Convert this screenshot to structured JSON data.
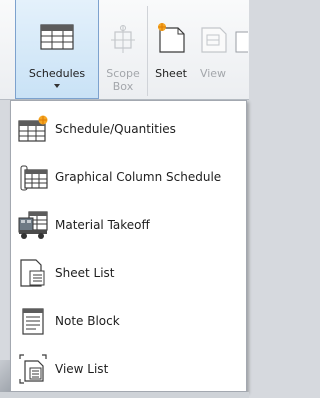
{
  "ribbon": {
    "schedules_label": "Schedules",
    "scope_box_label_line1": "Scope",
    "scope_box_label_line2": "Box",
    "sheet_label": "Sheet",
    "view_label": "View"
  },
  "menu": {
    "items": [
      {
        "label": "Schedule/Quantities",
        "icon": "schedule-quantities-icon"
      },
      {
        "label": "Graphical Column Schedule",
        "icon": "graphical-column-schedule-icon"
      },
      {
        "label": "Material Takeoff",
        "icon": "material-takeoff-icon"
      },
      {
        "label": "Sheet List",
        "icon": "sheet-list-icon"
      },
      {
        "label": "Note Block",
        "icon": "note-block-icon"
      },
      {
        "label": "View List",
        "icon": "view-list-icon"
      }
    ]
  },
  "colors": {
    "active_button_fill": "#c9e2f6",
    "active_button_border": "#7da2ce",
    "disabled_text": "#a3a6ab",
    "accent_orange": "#f5a623"
  }
}
